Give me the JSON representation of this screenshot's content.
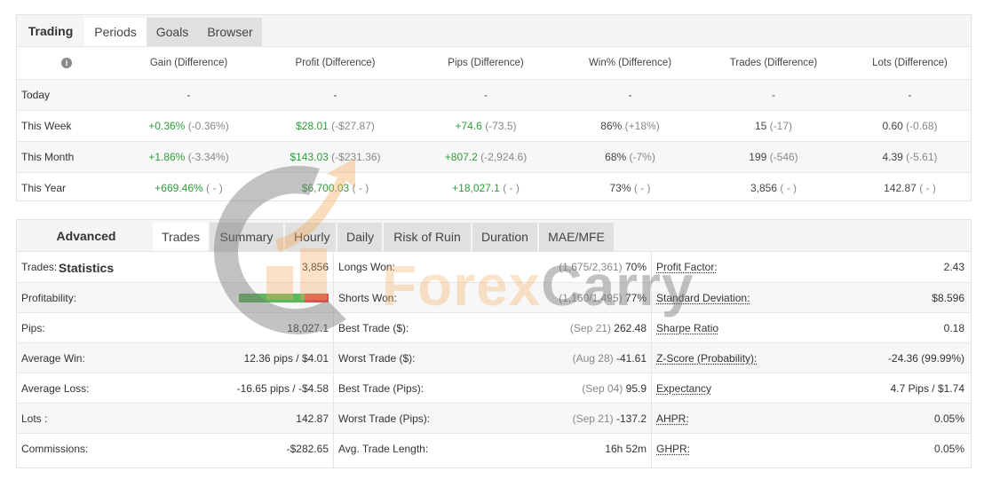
{
  "periods": {
    "tabs": [
      {
        "label": "Trading",
        "kind": "title"
      },
      {
        "label": "Periods",
        "kind": "active"
      },
      {
        "label": "Goals",
        "kind": "inactive"
      },
      {
        "label": "Browser",
        "kind": "inactive"
      }
    ],
    "info_icon": "info-icon",
    "columns": [
      "Gain (Difference)",
      "Profit (Difference)",
      "Pips (Difference)",
      "Win% (Difference)",
      "Trades (Difference)",
      "Lots (Difference)"
    ],
    "rows": [
      {
        "label": "Today",
        "cells": [
          [
            "-",
            ""
          ],
          [
            "-",
            ""
          ],
          [
            "-",
            ""
          ],
          [
            "-",
            ""
          ],
          [
            "-",
            ""
          ],
          [
            "-",
            ""
          ]
        ]
      },
      {
        "label": "This Week",
        "cells": [
          [
            "+0.36%",
            "(-0.36%)"
          ],
          [
            "$28.01",
            "(-$27.87)"
          ],
          [
            "+74.6",
            "(-73.5)"
          ],
          [
            "86%",
            "(+18%)"
          ],
          [
            "15",
            "(-17)"
          ],
          [
            "0.60",
            "(-0.68)"
          ]
        ]
      },
      {
        "label": "This Month",
        "cells": [
          [
            "+1.86%",
            "(-3.34%)"
          ],
          [
            "$143.03",
            "(-$231.36)"
          ],
          [
            "+807.2",
            "(-2,924.6)"
          ],
          [
            "68%",
            "(-7%)"
          ],
          [
            "199",
            "(-546)"
          ],
          [
            "4.39",
            "(-5.61)"
          ]
        ]
      },
      {
        "label": "This Year",
        "cells": [
          [
            "+669.46%",
            "( - )"
          ],
          [
            "$6,700.03",
            "( - )"
          ],
          [
            "+18,027.1",
            "( - )"
          ],
          [
            "73%",
            "( - )"
          ],
          [
            "3,856",
            "( - )"
          ],
          [
            "142.87",
            "( - )"
          ]
        ]
      }
    ]
  },
  "advanced": {
    "tabs": [
      {
        "label": "Advanced Statistics",
        "kind": "title"
      },
      {
        "label": "Trades",
        "kind": "active"
      },
      {
        "label": "Summary",
        "kind": "inactive"
      },
      {
        "label": "Hourly",
        "kind": "inactive"
      },
      {
        "label": "Daily",
        "kind": "inactive"
      },
      {
        "label": "Risk of Ruin",
        "kind": "inactive"
      },
      {
        "label": "Duration",
        "kind": "inactive"
      },
      {
        "label": "MAE/MFE",
        "kind": "inactive"
      }
    ],
    "col1": [
      {
        "label": "Trades:",
        "value": "3,856"
      },
      {
        "label": "Profitability:",
        "value": "",
        "profit_fraction": 0.73
      },
      {
        "label": "Pips:",
        "value": "18,027.1"
      },
      {
        "label": "Average Win:",
        "value": "12.36 pips / $4.01"
      },
      {
        "label": "Average Loss:",
        "value": "-16.65 pips / -$4.58"
      },
      {
        "label": "Lots :",
        "value": "142.87"
      },
      {
        "label": "Commissions:",
        "value": "-$282.65"
      }
    ],
    "col2": [
      {
        "label": "Longs Won:",
        "note": "(1,675/2,361)",
        "value": "70%"
      },
      {
        "label": "Shorts Won:",
        "note": "(1,160/1,495)",
        "value": "77%"
      },
      {
        "label": "Best Trade ($):",
        "note": "(Sep 21)",
        "value": "262.48"
      },
      {
        "label": "Worst Trade ($):",
        "note": "(Aug 28)",
        "value": "-41.61"
      },
      {
        "label": "Best Trade (Pips):",
        "note": "(Sep 04)",
        "value": "95.9"
      },
      {
        "label": "Worst Trade (Pips):",
        "note": "(Sep 21)",
        "value": "-137.2"
      },
      {
        "label": "Avg. Trade Length:",
        "note": "",
        "value": "16h 52m"
      }
    ],
    "col3": [
      {
        "label": "Profit Factor:",
        "value": "2.43"
      },
      {
        "label": "Standard Deviation:",
        "value": "$8.596"
      },
      {
        "label": "Sharpe Ratio",
        "value": "0.18"
      },
      {
        "label": "Z-Score (Probability):",
        "value": "-24.36 (99.99%)"
      },
      {
        "label": "Expectancy",
        "value": "4.7 Pips / $1.74"
      },
      {
        "label": "AHPR:",
        "value": "0.05%"
      },
      {
        "label": "GHPR:",
        "value": "0.05%"
      }
    ]
  },
  "watermark": {
    "text_a": "Forex",
    "text_b": "Carry"
  },
  "colors": {
    "positive": "#2e9c3b",
    "bar_green": "#5cb85c",
    "bar_red": "#d9534f",
    "tab_bg": "#f5f5f5"
  }
}
